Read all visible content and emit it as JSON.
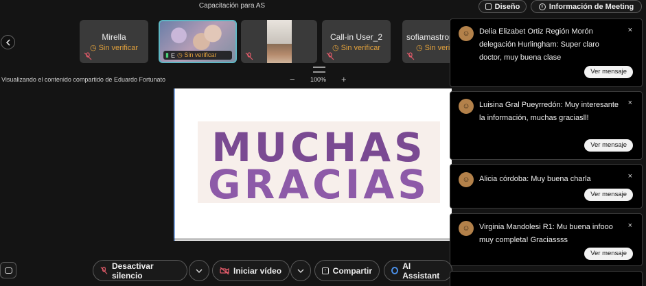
{
  "header": {
    "meeting_title": "Capacitación para AS",
    "design_button": "Diseño",
    "meeting_info_button": "Información de Meeting"
  },
  "participants": [
    {
      "name": "Mirella",
      "status": "Sin verificar"
    },
    {
      "name": "E",
      "status": "Sin verificar"
    },
    {
      "name": "",
      "status": ""
    },
    {
      "name": "Call-in User_2",
      "status": "Sin verificar"
    },
    {
      "name": "sofiamastrop",
      "status": "Sin verificar"
    }
  ],
  "viewer": {
    "sharing_label": "Visualizando el contenido compartido de Eduardo Fortunato",
    "zoom_level": "100%",
    "zoom_out": "−",
    "zoom_in": "+"
  },
  "slide": {
    "line1": "MUCHAS",
    "line2": "GRACIAS"
  },
  "toolbar": {
    "mute_label": "Desactivar silencio",
    "video_label": "Iniciar vídeo",
    "share_label": "Compartir",
    "ai_label": "AI Assistant"
  },
  "notifications": [
    {
      "message": "Delia Elizabet Ortiz Región Morón delegación Hurlingham: Super claro doctor, muy buena clase",
      "view_label": "Ver mensaje",
      "close": "×"
    },
    {
      "message": "Luisina Gral Pueyrredón: Muy interesante la información, muchas graciasll!",
      "view_label": "Ver mensaje",
      "close": "×"
    },
    {
      "message": "Alicia córdoba: Muy buena charla",
      "view_label": "Ver mensaje",
      "close": "×"
    },
    {
      "message": "Virginia Mandolesi R1: Mu buena infooo muy completa! Graciassss",
      "view_label": "Ver mensaje",
      "close": "×"
    }
  ],
  "colors": {
    "unverified": "#e3a23c",
    "slide_purple": "#7a4a92",
    "active_tile_border": "#5fb7c4"
  }
}
